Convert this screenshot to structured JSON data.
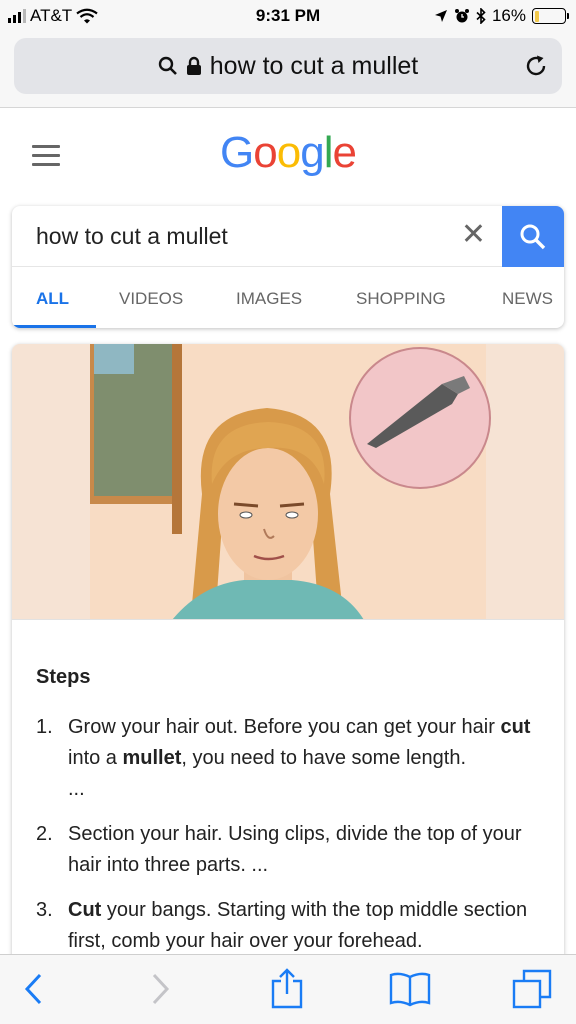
{
  "status_bar": {
    "carrier": "AT&T",
    "time": "9:31 PM",
    "battery": "16%",
    "battery_level": 0.16,
    "icons": [
      "signal-icon",
      "wifi-icon",
      "location-icon",
      "alarm-icon",
      "bluetooth-icon",
      "battery-icon"
    ]
  },
  "browser": {
    "url_text": "how to cut a mullet",
    "icons": [
      "search-icon",
      "lock-icon",
      "reload-icon"
    ]
  },
  "header": {
    "logo": "Google",
    "logo_colors": [
      "#4285F4",
      "#EA4335",
      "#FBBC05",
      "#4285F4",
      "#34A853",
      "#EA4335"
    ],
    "icons": [
      "menu-icon"
    ]
  },
  "search": {
    "query": "how to cut a mullet",
    "accent": "#4285F4",
    "icons": [
      "clear-icon",
      "search-icon"
    ]
  },
  "tabs": [
    {
      "label": "ALL",
      "active": true
    },
    {
      "label": "VIDEOS",
      "active": false
    },
    {
      "label": "IMAGES",
      "active": false
    },
    {
      "label": "SHOPPING",
      "active": false
    },
    {
      "label": "NEWS",
      "active": false
    }
  ],
  "result": {
    "steps_title": "Steps",
    "steps": [
      {
        "num": "1.",
        "line1_a": "Grow your hair out. Before you can get your hair",
        "bold1": "cut",
        "mid": " into a ",
        "bold2": "mullet",
        "line2_end": ", you need to have some length.",
        "ellipsis": "..."
      },
      {
        "num": "2.",
        "text": "Section your hair. Using clips, divide the top of your hair into three parts. ..."
      },
      {
        "num": "3.",
        "bold": "Cut",
        "text": " your bangs. Starting with the top middle section first, comb your hair over your forehead."
      }
    ]
  },
  "toolbar": {
    "icons": [
      "back-icon",
      "forward-icon",
      "share-icon",
      "bookmarks-icon",
      "tabs-icon"
    ],
    "tint": "#1a7cf5"
  }
}
